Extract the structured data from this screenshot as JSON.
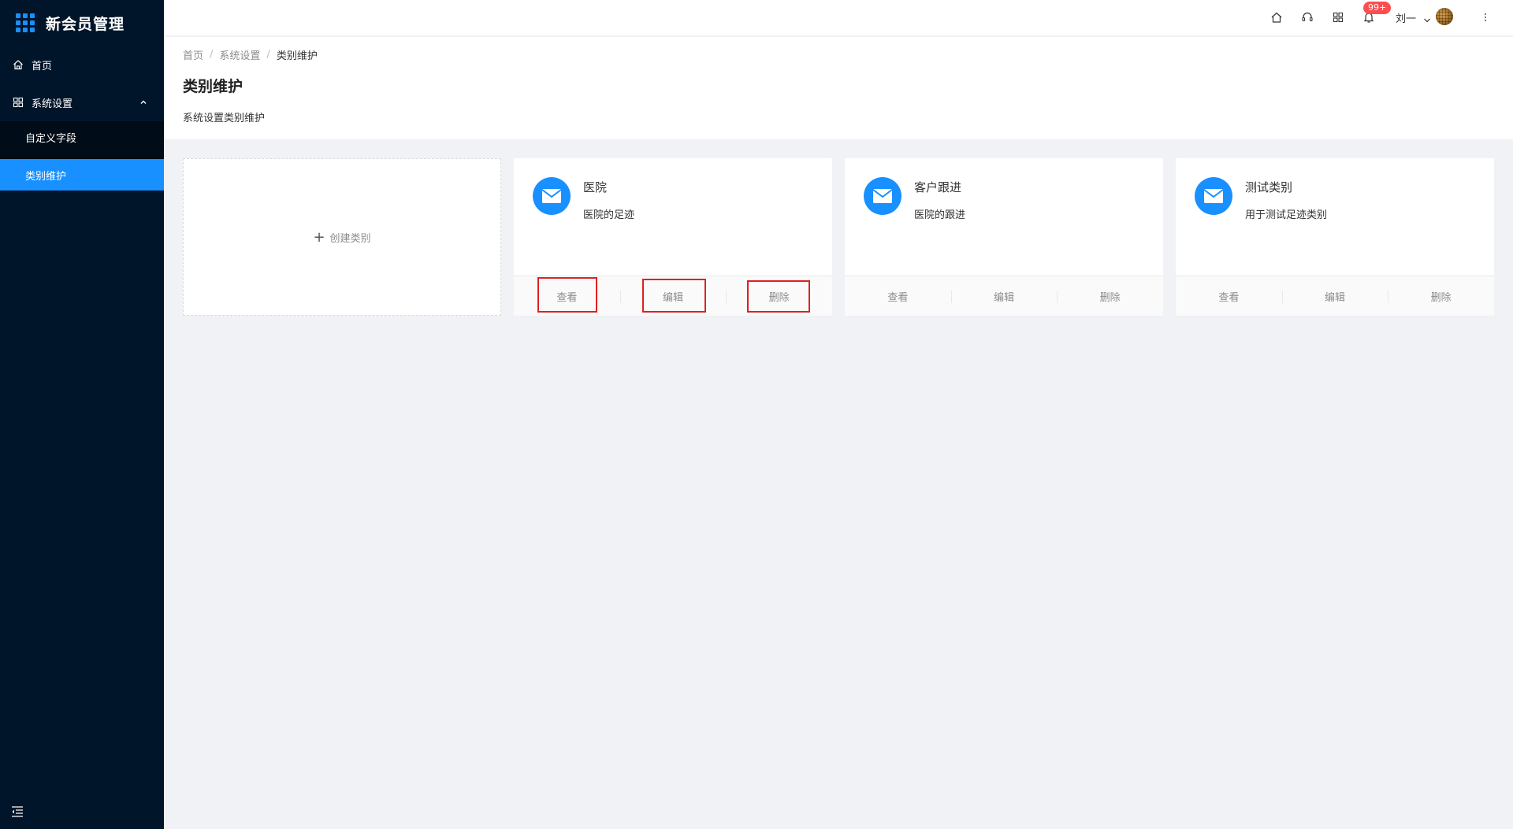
{
  "app": {
    "title": "新会员管理"
  },
  "sidebar": {
    "items": [
      {
        "label": "首页",
        "icon": "home-icon"
      },
      {
        "label": "系统设置",
        "icon": "appstore-icon",
        "expanded": true,
        "children": [
          {
            "label": "自定义字段",
            "active": false
          },
          {
            "label": "类别维护",
            "active": true
          }
        ]
      }
    ]
  },
  "header": {
    "notification_count": "99+",
    "user_name": "刘一"
  },
  "breadcrumb": [
    "首页",
    "系统设置",
    "类别维护"
  ],
  "page": {
    "title": "类别维护",
    "description": "系统设置类别维护"
  },
  "create_card": {
    "label": "创建类别"
  },
  "cards": [
    {
      "title": "医院",
      "description": "医院的足迹",
      "actions": [
        "查看",
        "编辑",
        "删除"
      ]
    },
    {
      "title": "客户跟进",
      "description": "医院的跟进",
      "actions": [
        "查看",
        "编辑",
        "删除"
      ]
    },
    {
      "title": "测试类别",
      "description": "用于测试足迹类别",
      "actions": [
        "查看",
        "编辑",
        "删除"
      ]
    }
  ],
  "colors": {
    "primary": "#1890ff",
    "sidebar_bg": "#001529",
    "highlight": "#e02020"
  }
}
